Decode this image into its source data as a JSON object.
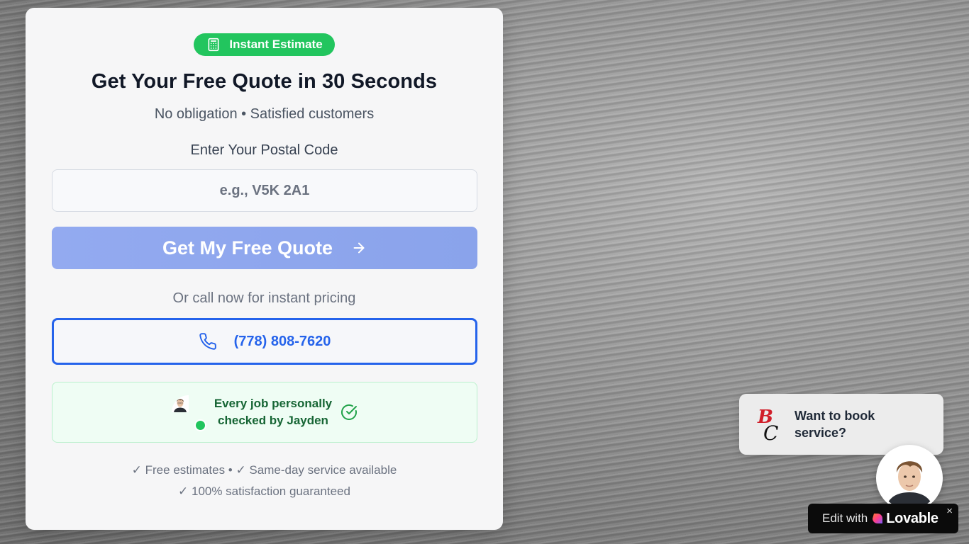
{
  "badge": {
    "label": "Instant Estimate",
    "icon": "calculator-icon"
  },
  "quote_form": {
    "title": "Get Your Free Quote in 30 Seconds",
    "subtitle": "No obligation • Satisfied customers",
    "postal_label": "Enter Your Postal Code",
    "postal_placeholder": "e.g., V5K 2A1",
    "postal_value": "",
    "submit_label": "Get My Free Quote",
    "or_call_text": "Or call now for instant pricing",
    "phone_number": "(778) 808-7620"
  },
  "verification": {
    "line1": "Every job personally",
    "line2": "checked by Jayden"
  },
  "perks": {
    "line1": "✓ Free estimates • ✓ Same-day service available",
    "line2": "✓ 100% satisfaction guaranteed"
  },
  "chat_widget": {
    "line1": "Want to book",
    "line2": "service?"
  },
  "lovable_badge": {
    "prefix": "Edit with",
    "brand": "Lovable",
    "close": "×"
  },
  "colors": {
    "badge_green": "#22c55e",
    "cta_blue_disabled": "#8fa6ee",
    "phone_blue": "#2563eb",
    "verify_green_text": "#166534",
    "verify_bg": "#effdf4"
  }
}
